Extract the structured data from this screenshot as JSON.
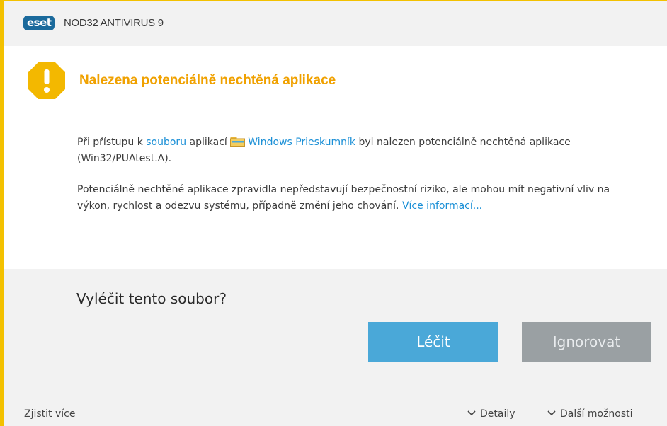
{
  "window": {
    "logo_text": "eset",
    "app_title": "NOD32 ANTIVIRUS 9",
    "accent_color": "#f3c100"
  },
  "alert": {
    "icon": "warning-icon",
    "title": "Nalezena potenciálně nechtěná aplikace",
    "title_color": "#f0a100"
  },
  "message": {
    "p1_a": "Při přístupu k ",
    "p1_link_file": "souboru",
    "p1_b": " aplikací ",
    "p1_app_icon": "windows-explorer-icon",
    "p1_link_app": "Windows Prieskumník",
    "p1_c": "  byl nalezen potenciálně nechtěná aplikace (Win32/PUAtest.A).",
    "p2_a": "Potenciálně nechtěné aplikace zpravidla nepředstavují bezpečnostní riziko, ale mohou mít negativní vliv na výkon, rychlost a odezvu systému, případně změní jeho chování. ",
    "p2_link_more": "Více informací..."
  },
  "actions": {
    "question": "Vyléčit tento soubor?",
    "clean_label": "Léčit",
    "ignore_label": "Ignorovat",
    "clean_color": "#4aa8d8",
    "ignore_color": "#9aa0a3"
  },
  "footer": {
    "learn_more": "Zjistit více",
    "details": "Detaily",
    "more_options": "Další možnosti"
  }
}
